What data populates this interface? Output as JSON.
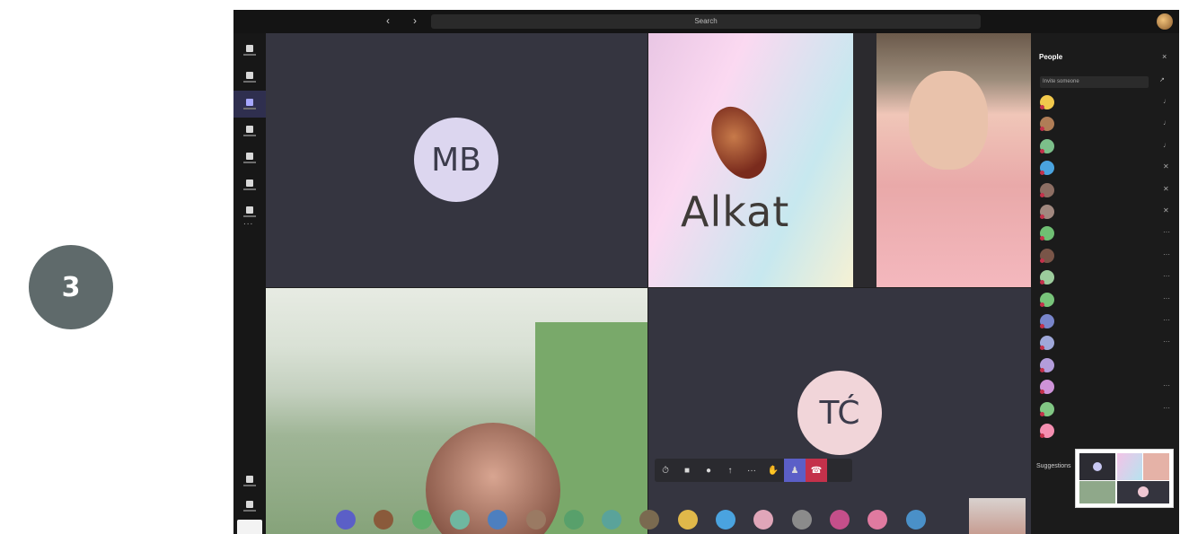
{
  "step": {
    "number": "3"
  },
  "titlebar": {
    "back_icon": "chevron-left-icon",
    "forward_icon": "chevron-right-icon",
    "search_placeholder": "Search"
  },
  "rail": {
    "items": [
      "Activity",
      "Chat",
      "Teams",
      "Assignments",
      "Calendar",
      "Calls",
      "Files"
    ],
    "more": "...",
    "bottom_items": [
      "Apps",
      "Help"
    ]
  },
  "stage": {
    "tiles": [
      {
        "initials": "MB",
        "name": ""
      },
      {
        "brand": "Alkat",
        "name": ""
      },
      {
        "name": ""
      },
      {
        "initials": "TĆ",
        "name": ""
      }
    ]
  },
  "controls": {
    "icons": [
      "timer-icon",
      "camera-icon",
      "mic-icon",
      "share-icon",
      "more-icon",
      "raise-hand-icon",
      "chat-icon",
      "hangup-icon"
    ],
    "more": "···"
  },
  "people_panel": {
    "title": "People",
    "close": "×",
    "invite_placeholder": "Invite someone",
    "share_icon": "share-link-icon",
    "participants": [
      {
        "color": "#f2c94c",
        "status": "mic-icon"
      },
      {
        "color": "#b07d56",
        "status": "mic-icon"
      },
      {
        "color": "#7cbf8a",
        "status": "mic-icon"
      },
      {
        "color": "#4aa3df",
        "status": "mic-off-icon"
      },
      {
        "color": "#8d6e63",
        "status": "mic-off-icon"
      },
      {
        "color": "#a1887f",
        "status": "mic-off-icon"
      },
      {
        "color": "#6fbf73",
        "status": "more-icon"
      },
      {
        "color": "#795548",
        "status": "more-icon"
      },
      {
        "color": "#9ccc9c",
        "status": "more-icon"
      },
      {
        "color": "#78c47a",
        "status": "more-icon"
      },
      {
        "color": "#7986cb",
        "status": "more-icon"
      },
      {
        "color": "#9fa8da",
        "status": "more-icon"
      },
      {
        "color": "#b39ddb",
        "status": ""
      },
      {
        "color": "#ce93d8",
        "status": "more-icon"
      },
      {
        "color": "#81c784",
        "status": "more-icon"
      },
      {
        "color": "#f48fb1",
        "status": ""
      }
    ],
    "section": "Suggestions"
  },
  "gallery": {
    "avatars": [
      "#5b5fc7",
      "#8a5a3b",
      "#5fae6b",
      "#6fb7a0",
      "#4d7fbf",
      "#9a7a63",
      "#58a06b",
      "#5aa39a",
      "#7a6a50",
      "#e0b84a",
      "#4aa3df",
      "#e0a6b9",
      "#8b8b8b",
      "#c44f8a",
      "#e07aa0",
      "#4a90c8"
    ]
  }
}
